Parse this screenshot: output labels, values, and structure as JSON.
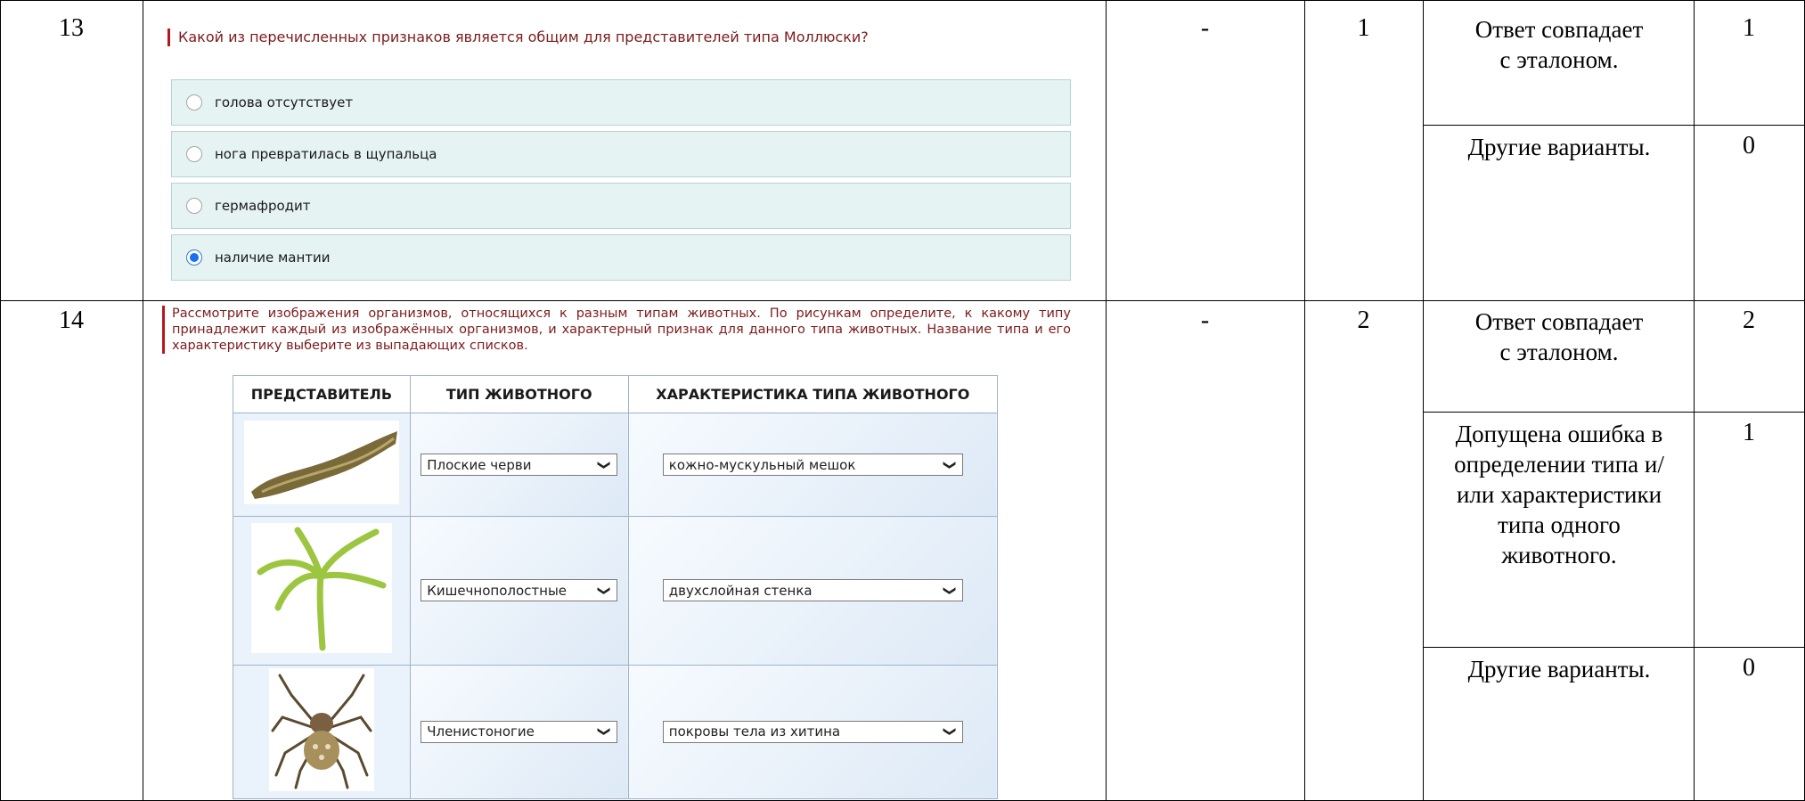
{
  "rows": [
    {
      "number": "13",
      "answer": "-",
      "max_score": "1",
      "criteria": [
        {
          "text": "Ответ совпадает с эталоном.",
          "score": "1"
        },
        {
          "text": "Другие варианты.",
          "score": "0"
        }
      ]
    },
    {
      "number": "14",
      "answer": "-",
      "max_score": "2",
      "criteria": [
        {
          "text": "Ответ совпадает с эталоном.",
          "score": "2"
        },
        {
          "text": "Допущена ошибка в определении типа и/или характеристики типа одного животного.",
          "score": "1"
        },
        {
          "text": "Другие варианты.",
          "score": "0"
        }
      ]
    }
  ],
  "q13": {
    "question": "Какой из перечисленных признаков является общим для представителей типа Моллюски?",
    "options": [
      {
        "label": "голова отсутствует",
        "checked": false
      },
      {
        "label": "нога превратилась в щупальца",
        "checked": false
      },
      {
        "label": "гермафродит",
        "checked": false
      },
      {
        "label": "наличие мантии",
        "checked": true
      }
    ]
  },
  "q14": {
    "question": "Рассмотрите изображения организмов, относящихся к разным типам животных. По рисункам определите, к какому типу принадлежит каждый из изображённых организмов, и характерный признак для данного типа животных. Название типа и его характеристику выберите из выпадающих списков.",
    "headers": [
      "ПРЕДСТАВИТЕЛЬ",
      "ТИП ЖИВОТНОГО",
      "ХАРАКТЕРИСТИКА ТИПА ЖИВОТНОГО"
    ],
    "rows": [
      {
        "image": "flatworm-image",
        "type": "Плоские черви",
        "feature": "кожно-мускульный мешок"
      },
      {
        "image": "hydra-image",
        "type": "Кишечнополостные",
        "feature": "двухслойная стенка"
      },
      {
        "image": "spider-image",
        "type": "Членистоногие",
        "feature": "покровы тела из хитина"
      }
    ]
  }
}
